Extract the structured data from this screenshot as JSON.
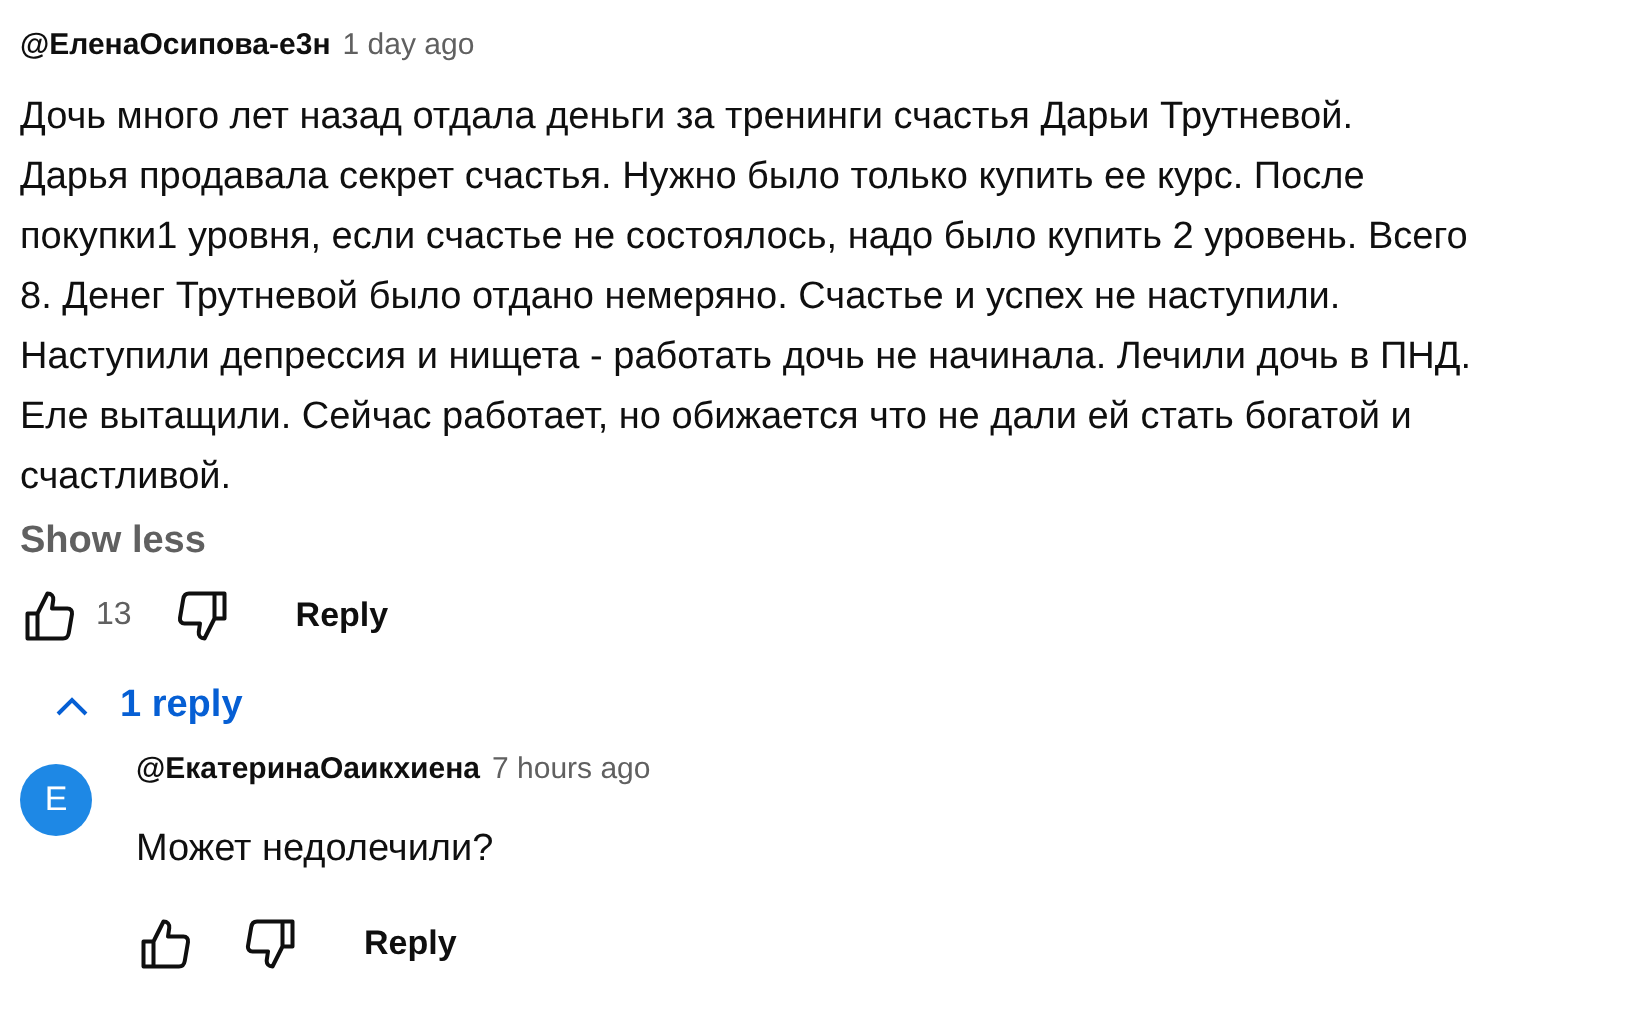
{
  "comment": {
    "author": "@ЕленаОсипова-е3н",
    "time": "1 day ago",
    "text_lines": [
      "Дочь много лет назад отдала деньги за тренинги счастья Дарьи Трутневой.",
      "Дарья продавала секрет счастья. Нужно было только купить ее курс. После",
      "покупки1 уровня, если счастье не состоялось, надо было купить 2 уровень. Всего",
      "8. Денег Трутневой было отдано немеряно. Счастье и успех не наступили.",
      "Наступили депрессия и нищета - работать дочь не начинала. Лечили дочь в ПНД.",
      "Еле вытащили. Сейчас работает, но обижается что не дали ей стать богатой и",
      "счастливой."
    ],
    "toggle": "Show less",
    "likes": "13",
    "reply_button": "Reply"
  },
  "replies_toggle": {
    "label": "1 reply",
    "expanded": true
  },
  "replies": [
    {
      "avatar_letter": "E",
      "author": "@ЕкатеринаОаикхиена",
      "time": "7 hours ago",
      "text": "Может недолечили?",
      "reply_button": "Reply"
    }
  ]
}
